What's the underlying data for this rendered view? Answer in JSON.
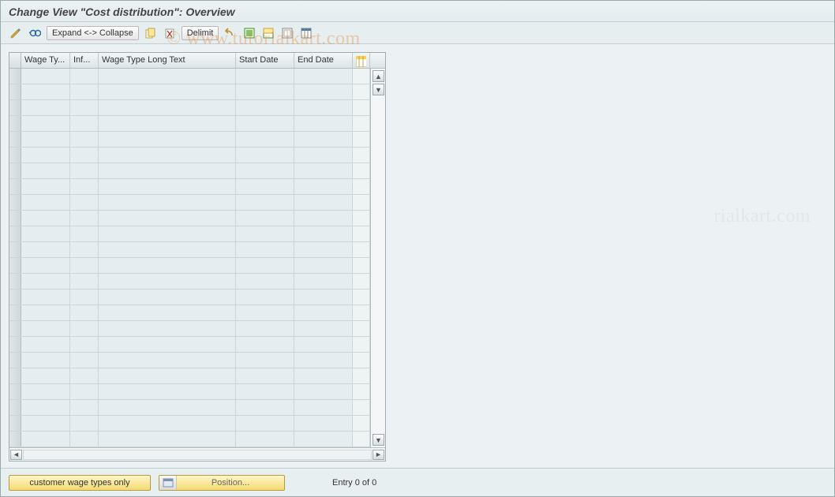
{
  "title": "Change View \"Cost distribution\": Overview",
  "toolbar": {
    "expand_collapse_label": "Expand <-> Collapse",
    "delimit_label": "Delimit",
    "icons": {
      "pencil": "edit-icon",
      "glasses": "display-icon",
      "copy": "copy-icon",
      "delete": "delete-icon",
      "undo": "undo-icon",
      "select_all": "select-all-icon",
      "deselect_all": "deselect-all-icon",
      "config": "configuration-icon"
    }
  },
  "table": {
    "columns": {
      "wage_type": "Wage Ty...",
      "inf": "Inf...",
      "wage_type_long_text": "Wage Type Long Text",
      "start_date": "Start Date",
      "end_date": "End Date"
    },
    "config_icon": "table-settings-icon",
    "row_count": 24
  },
  "footer": {
    "customer_btn": "customer wage types only",
    "position_btn": "Position...",
    "entry_text": "Entry 0 of 0"
  },
  "watermark": "© www.tutorialkart.com",
  "watermark2": "rialkart.com"
}
